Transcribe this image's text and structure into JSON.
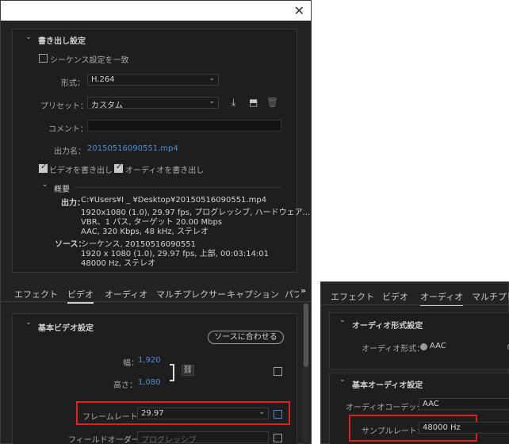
{
  "left": {
    "close_glyph": "✕",
    "export_settings_title": "書き出し設定",
    "match_sequence_label": "シーケンス設定を一致",
    "format_label": "形式：",
    "format_value": "H.264",
    "preset_label": "プリセット：",
    "preset_value": "カスタム",
    "comment_label": "コメント：",
    "output_name_label": "出力名：",
    "output_name_value": "20150516090551.mp4",
    "export_video_label": "ビデオを書き出し",
    "export_audio_label": "オーディオを書き出し",
    "summary_title": "概要",
    "output_heading": "出力：",
    "output_lines": [
      "C:¥Users¥I  _   ¥Desktop¥20150516090551.mp4",
      "1920x1080 (1.0), 29.97 fps, プログレッシブ, ハードウェア...",
      "VBR、1 パス, ターゲット 20.00 Mbps",
      "AAC, 320 Kbps, 48 kHz, ステレオ"
    ],
    "source_heading": "ソース：",
    "source_lines": [
      "シーケンス, 20150516090551",
      "1920 x 1080 (1.0), 29.97 fps, 上部, 00:03:14:01",
      "48000 Hz, ステレオ"
    ],
    "tabs": [
      "エフェクト",
      "ビデオ",
      "オーディオ",
      "マルチプレクサー",
      "キャプション",
      "パブ"
    ],
    "tabs_more": "»",
    "basic_video_title": "基本ビデオ設定",
    "match_source_button": "ソースに合わせる",
    "width_label": "幅：",
    "width_value": "1,920",
    "height_label": "高さ：",
    "height_value": "1,080",
    "framerate_label": "フレームレート：",
    "framerate_value": "29.97",
    "field_order_label": "フィールドオーダー：",
    "field_order_value": "プログレッシブ"
  },
  "right": {
    "tabs": [
      "エフェクト",
      "ビデオ",
      "オーディオ",
      "マルチプレク"
    ],
    "audio_format_title": "オーディオ形式設定",
    "audio_format_label": "オーディオ形式：",
    "audio_format_value": "AAC",
    "basic_audio_title": "基本オーディオ設定",
    "audio_codec_label": "オーディオコーデック：",
    "audio_codec_value": "AAC",
    "sample_rate_label": "サンプルレート：",
    "sample_rate_value": "48000 Hz"
  },
  "colors": {
    "highlight": "#e02020",
    "link": "#4b8fd6",
    "panel": "#232323"
  }
}
